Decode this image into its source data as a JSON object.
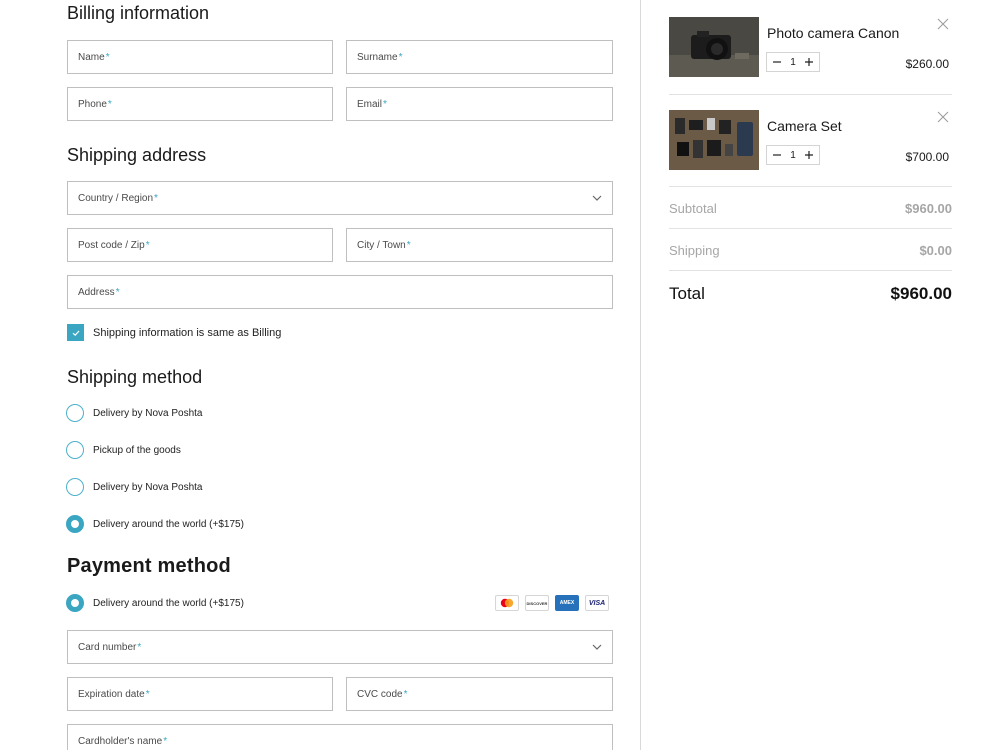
{
  "billing": {
    "title": "Billing information",
    "name": "Name",
    "surname": "Surname",
    "phone": "Phone",
    "email": "Email"
  },
  "shipping_address": {
    "title": "Shipping address",
    "country": "Country / Region",
    "postcode": "Post code / Zip",
    "city": "City / Town",
    "address": "Address",
    "same_as_billing": "Shipping information is same as Billing"
  },
  "shipping_method": {
    "title": "Shipping method",
    "options": [
      {
        "label": "Delivery by Nova Poshta",
        "selected": false
      },
      {
        "label": "Pickup of the goods",
        "selected": false
      },
      {
        "label": "Delivery by Nova Poshta",
        "selected": false
      },
      {
        "label": "Delivery around the world (+$175)",
        "selected": true
      }
    ]
  },
  "payment_method": {
    "title": "Payment method",
    "option_label": "Delivery around the world (+$175)",
    "card_brands": [
      "mastercard",
      "discover",
      "amex",
      "visa"
    ],
    "discover_text": "DISCOVER",
    "amex_text": "AMEX",
    "visa_text": "VISA",
    "card_number": "Card number",
    "expiration": "Expiration date",
    "cvc": "CVC code",
    "cardholder": "Cardholder's name"
  },
  "required_marker": "*",
  "cart": {
    "items": [
      {
        "name": "Photo camera Canon",
        "qty": "1",
        "price": "$260.00"
      },
      {
        "name": "Camera Set",
        "qty": "1",
        "price": "$700.00"
      }
    ],
    "subtotal_label": "Subtotal",
    "subtotal_value": "$960.00",
    "shipping_label": "Shipping",
    "shipping_value": "$0.00",
    "total_label": "Total",
    "total_value": "$960.00"
  },
  "colors": {
    "accent": "#3aa6c2",
    "border": "#bfbfbf",
    "muted": "#a6a6a6"
  }
}
